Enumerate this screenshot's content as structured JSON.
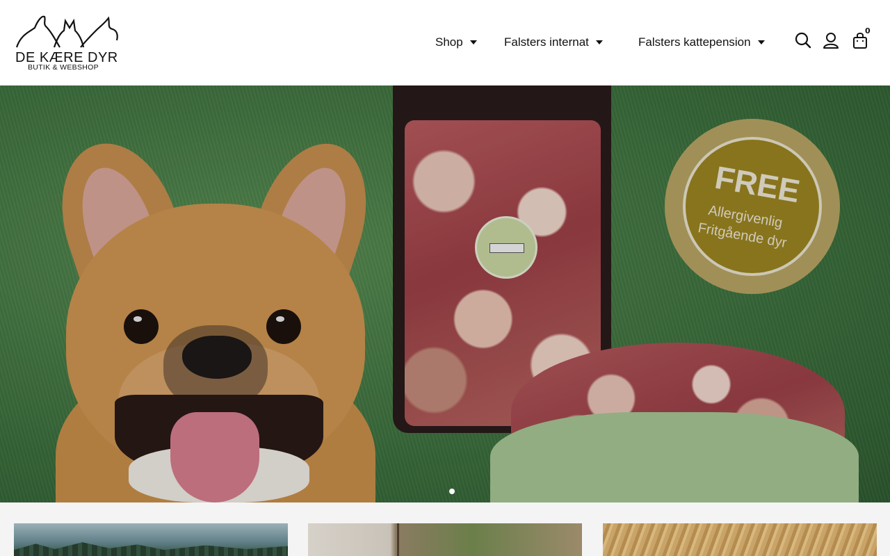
{
  "brand": {
    "name": "DE KÆRE DYR",
    "tagline": "BUTIK & WEBSHOP"
  },
  "nav": {
    "items": [
      {
        "label": "Shop"
      },
      {
        "label": "Falsters internat"
      },
      {
        "label": "Falsters kattepension"
      }
    ]
  },
  "header_icons": {
    "search": "search-icon",
    "account": "user-icon",
    "cart": "shopping-bag-icon",
    "cart_count": "0"
  },
  "hero": {
    "badge_title": "FREE",
    "badge_line1": "Allergivenlig",
    "badge_line2": "Fritgående dyr",
    "slides_total": 1,
    "active_slide": 1
  },
  "colors": {
    "header_bg": "#ffffff",
    "page_bg": "#f4f4f4",
    "badge": "#9b8420"
  }
}
